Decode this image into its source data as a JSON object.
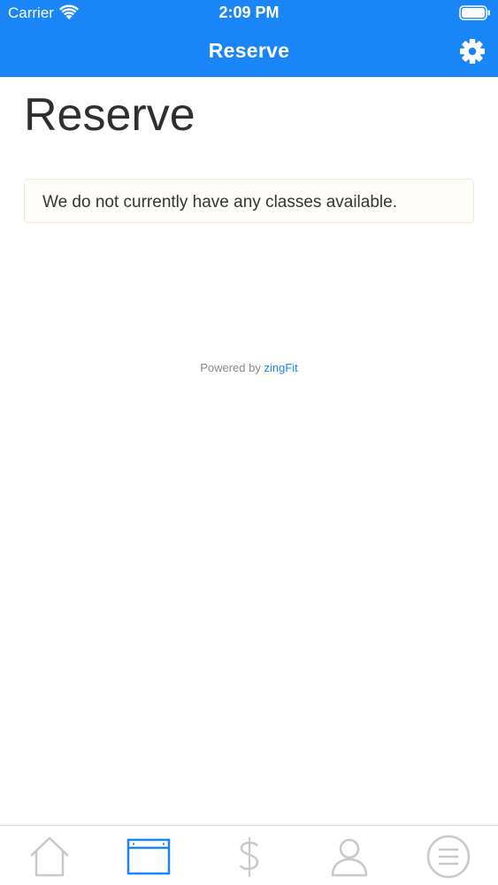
{
  "status_bar": {
    "carrier": "Carrier",
    "time": "2:09 PM"
  },
  "nav": {
    "title": "Reserve",
    "settings_icon": "gear-icon"
  },
  "main": {
    "heading": "Reserve",
    "notice": "We do not currently have any classes available.",
    "powered_prefix": "Powered by",
    "powered_brand": "zingFit"
  },
  "tabs": [
    {
      "icon": "home-icon",
      "active": false
    },
    {
      "icon": "calendar-icon",
      "active": true
    },
    {
      "icon": "dollar-icon",
      "active": false
    },
    {
      "icon": "user-icon",
      "active": false
    },
    {
      "icon": "menu-icon",
      "active": false
    }
  ],
  "colors": {
    "accent": "#1a85f7",
    "inactive_tab": "#c8c8c8"
  }
}
